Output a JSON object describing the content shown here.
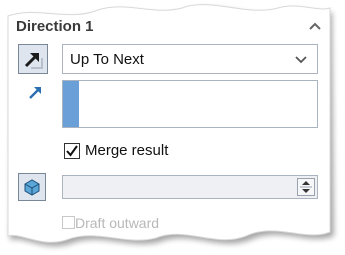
{
  "header": {
    "title": "Direction 1",
    "collapse_icon": "chevron-up-icon"
  },
  "end_condition": {
    "icon": "direction-arrow-icon",
    "selected": "Up To Next"
  },
  "direction_ref": {
    "icon": "blue-arrow-icon",
    "value": ""
  },
  "merge": {
    "label": "Merge result",
    "checked": true
  },
  "feature_scope": {
    "icon": "solid-body-icon",
    "value": ""
  },
  "partial_label": "Draft outward",
  "colors": {
    "accent": "#6a9fd8",
    "border": "#aab4c0",
    "icon_bg": "#dfe5ee"
  }
}
